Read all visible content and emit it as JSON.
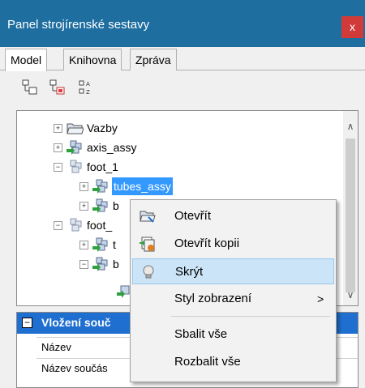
{
  "window": {
    "title": "Panel strojírenské sestavy",
    "close_label": "x"
  },
  "tabs": [
    "Model",
    "Knihovna",
    "Zpráva"
  ],
  "toolbar": {
    "icons": [
      "tree-view-icon",
      "tree-filter-icon",
      "sort-az-icon"
    ]
  },
  "tree": {
    "items": [
      {
        "label": "Vazby",
        "icon": "folder-icon",
        "expander": "+"
      },
      {
        "label": "axis_assy",
        "icon": "assembly-icon",
        "expander": "+"
      },
      {
        "label": "foot_1",
        "icon": "assembly-icon",
        "expander": "−"
      },
      {
        "label": "tubes_assy",
        "icon": "assembly-icon",
        "expander": "+"
      },
      {
        "label": "b",
        "icon": "assembly-icon",
        "expander": "+"
      },
      {
        "label": "foot_",
        "icon": "assembly-icon",
        "expander": "−"
      },
      {
        "label": "t",
        "icon": "assembly-icon",
        "expander": "+"
      },
      {
        "label": "b",
        "icon": "assembly-icon",
        "expander": "−"
      }
    ]
  },
  "properties": {
    "header": "Vložení souč",
    "rows": [
      "Název",
      "Název součás"
    ]
  },
  "context_menu": {
    "items": [
      {
        "label": "Otevřít",
        "icon": "open-icon"
      },
      {
        "label": "Otevřít kopii",
        "icon": "open-copy-icon"
      },
      {
        "label": "Skrýt",
        "icon": "lightbulb-icon"
      },
      {
        "label": "Styl zobrazení",
        "submenu_arrow": ">"
      },
      {
        "label": "Sbalit vše"
      },
      {
        "label": "Rozbalit vše"
      }
    ]
  }
}
